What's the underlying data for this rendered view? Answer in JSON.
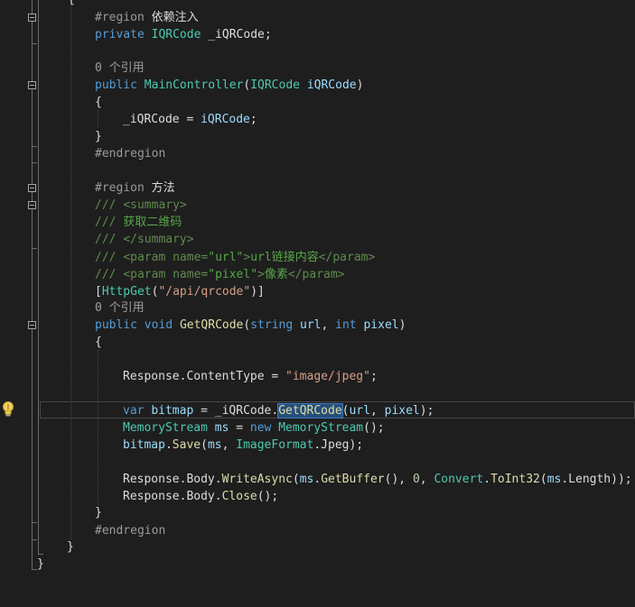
{
  "editor": {
    "lines": {
      "l0": [
        "{"
      ],
      "l1": [
        "#region",
        " 依赖注入"
      ],
      "l2": [
        "private",
        " ",
        "IQRCode",
        " _iQRCode;"
      ],
      "l3": [
        "0 个引用"
      ],
      "l4": [
        "public",
        " ",
        "MainController",
        "(",
        "IQRCode",
        " ",
        "iQRCode",
        ")"
      ],
      "l5": [
        "{"
      ],
      "l6": [
        "_iQRCode = ",
        "iQRCode",
        ";"
      ],
      "l7": [
        "}"
      ],
      "l8": [
        "#endregion"
      ],
      "l9": [
        "#region",
        " 方法"
      ],
      "l10": [
        "/// ",
        "<summary>"
      ],
      "l11": [
        "/// ",
        "获取二维码"
      ],
      "l12": [
        "/// ",
        "</summary>"
      ],
      "l13": [
        "/// ",
        "<param",
        " name=",
        "\"url\"",
        ">",
        "url链接内容",
        "</param>"
      ],
      "l14": [
        "/// ",
        "<param",
        " name=",
        "\"pixel\"",
        ">",
        "像素",
        "</param>"
      ],
      "l15": [
        "[",
        "HttpGet",
        "(",
        "\"/api/qrcode\"",
        ")]"
      ],
      "l16": [
        "0 个引用"
      ],
      "l17": [
        "public",
        " ",
        "void",
        " ",
        "GetQRCode",
        "(",
        "string",
        " ",
        "url",
        ", ",
        "int",
        " ",
        "pixel",
        ")"
      ],
      "l18": [
        "{"
      ],
      "l19": [
        "Response",
        ".",
        "ContentType",
        " = ",
        "\"image/jpeg\"",
        ";"
      ],
      "l20": [
        "var",
        " ",
        "bitmap",
        " = _iQRCode.",
        "GetQRCode",
        "(",
        "url",
        ", ",
        "pixel",
        ");"
      ],
      "l21": [
        "MemoryStream",
        " ",
        "ms",
        " = ",
        "new",
        " ",
        "MemoryStream",
        "();"
      ],
      "l22": [
        "bitmap",
        ".",
        "Save",
        "(",
        "ms",
        ", ",
        "ImageFormat",
        ".",
        "Jpeg",
        ");"
      ],
      "l23": [
        "Response",
        ".",
        "Body",
        ".",
        "WriteAsync",
        "(",
        "ms",
        ".",
        "GetBuffer",
        "(), ",
        "0",
        ", ",
        "Convert",
        ".",
        "ToInt32",
        "(",
        "ms",
        ".",
        "Length",
        "));"
      ],
      "l24": [
        "Response",
        ".",
        "Body",
        ".",
        "Close",
        "();"
      ],
      "l25": [
        "}"
      ],
      "l26": [
        "#endregion"
      ],
      "l27": [
        "}"
      ],
      "l28": [
        "}"
      ]
    }
  },
  "colors": {
    "background": "#1e1e1e",
    "keyword": "#569cd6",
    "type": "#4ec9b0",
    "method": "#dcdcaa",
    "string": "#d69d85",
    "number": "#b5cea8",
    "comment": "#57a64a",
    "selection": "#264f78"
  },
  "icons": {
    "lightbulb": "lightbulb-icon",
    "fold": "collapse-box-icon"
  }
}
